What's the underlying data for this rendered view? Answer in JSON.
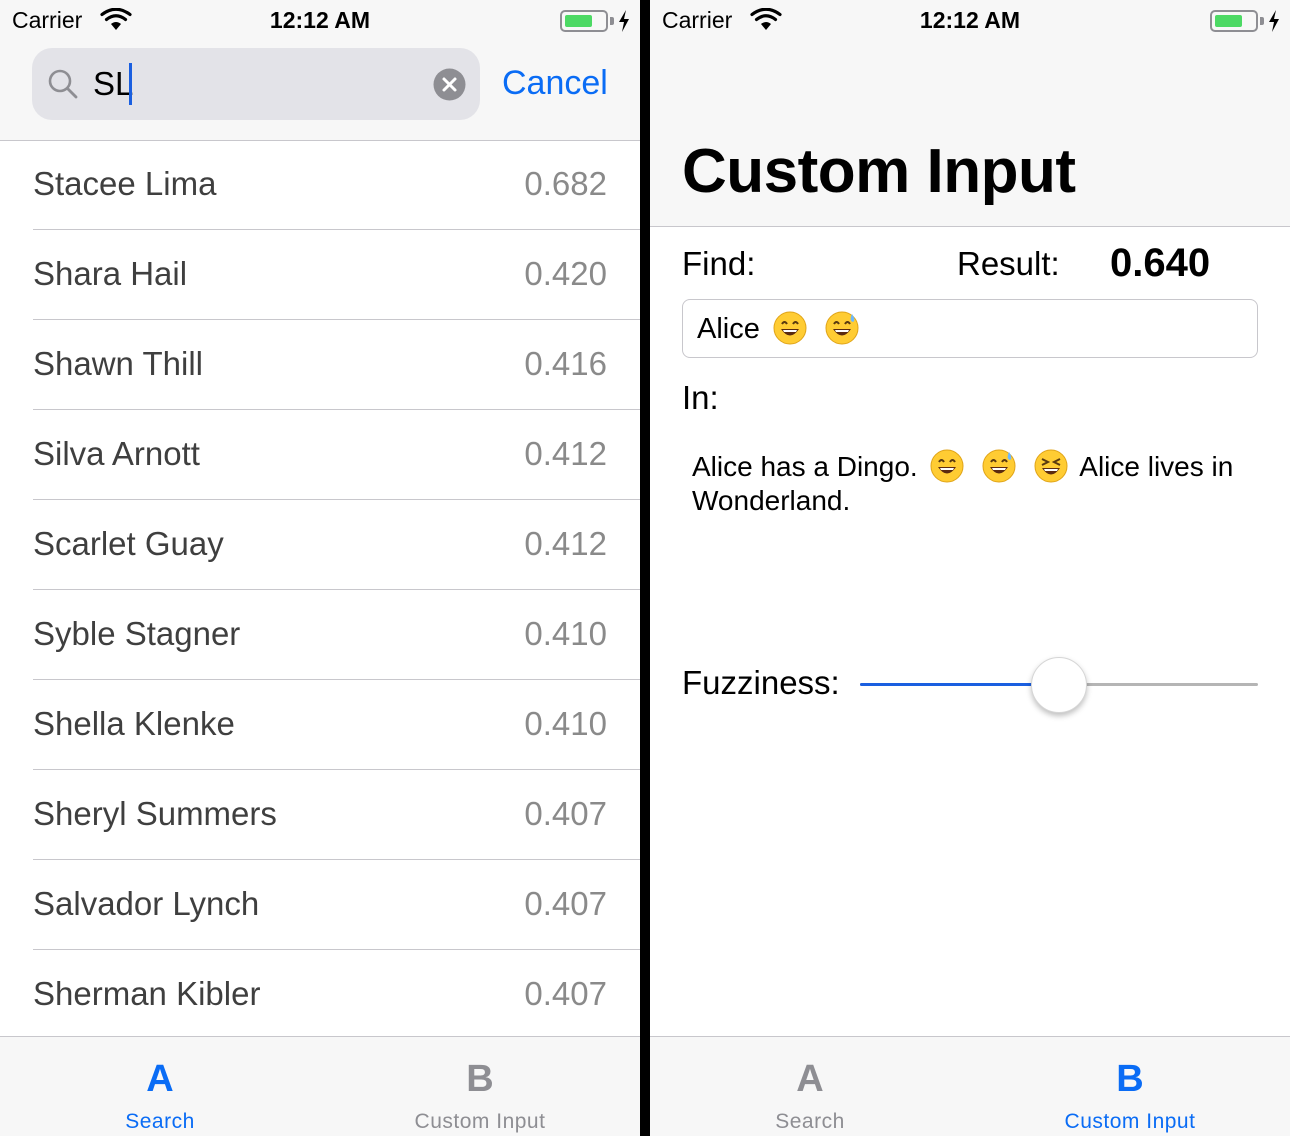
{
  "left": {
    "status_bar": {
      "carrier": "Carrier",
      "time": "12:12 AM",
      "battery_level": 0.7
    },
    "search": {
      "query": "SL",
      "cancel_label": "Cancel"
    },
    "results": [
      {
        "name": "Stacee Lima",
        "score": "0.682"
      },
      {
        "name": "Shara Hail",
        "score": "0.420"
      },
      {
        "name": "Shawn Thill",
        "score": "0.416"
      },
      {
        "name": "Silva Arnott",
        "score": "0.412"
      },
      {
        "name": "Scarlet Guay",
        "score": "0.412"
      },
      {
        "name": "Syble Stagner",
        "score": "0.410"
      },
      {
        "name": "Shella Klenke",
        "score": "0.410"
      },
      {
        "name": "Sheryl Summers",
        "score": "0.407"
      },
      {
        "name": "Salvador Lynch",
        "score": "0.407"
      },
      {
        "name": "Sherman Kibler",
        "score": "0.407"
      }
    ],
    "tabs": [
      {
        "icon": "A",
        "label": "Search",
        "active": true
      },
      {
        "icon": "B",
        "label": "Custom Input",
        "active": false
      }
    ]
  },
  "right": {
    "status_bar": {
      "carrier": "Carrier",
      "time": "12:12 AM",
      "battery_level": 0.7
    },
    "title": "Custom Input",
    "find_label": "Find:",
    "result_label": "Result:",
    "result_value": "0.640",
    "find_value": "Alice 😄 😅",
    "in_label": "In:",
    "in_text": "Alice has a Dingo. 😄 😅 😆 Alice lives in Wonderland.",
    "fuzziness_label": "Fuzziness:",
    "fuzziness_value": 0.5,
    "tabs": [
      {
        "icon": "A",
        "label": "Search",
        "active": false
      },
      {
        "icon": "B",
        "label": "Custom Input",
        "active": true
      }
    ]
  },
  "colors": {
    "accent": "#0a6cf5",
    "slider_fill": "#1a5fe0",
    "battery": "#4cd964",
    "inactive_tab": "#8e8e93"
  },
  "icons": [
    "wifi-icon",
    "battery-icon",
    "charging-bolt-icon",
    "search-icon",
    "clear-icon",
    "grinning-face-emoji",
    "sweat-smile-emoji",
    "laughing-face-emoji"
  ]
}
